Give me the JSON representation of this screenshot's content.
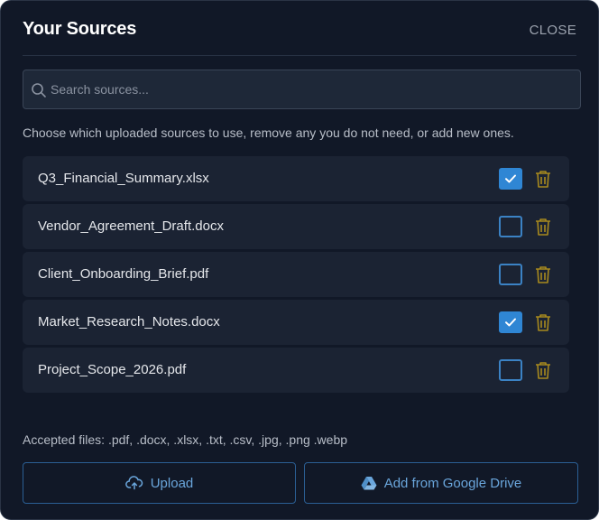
{
  "dialog": {
    "title": "Your Sources",
    "close_label": "CLOSE"
  },
  "search": {
    "placeholder": "Search sources...",
    "value": ""
  },
  "description": "Choose which uploaded sources to use, remove any you do not need, or add new ones.",
  "sources": [
    {
      "name": "Q3_Financial_Summary.xlsx",
      "selected": true
    },
    {
      "name": "Vendor_Agreement_Draft.docx",
      "selected": false
    },
    {
      "name": "Client_Onboarding_Brief.pdf",
      "selected": false
    },
    {
      "name": "Market_Research_Notes.docx",
      "selected": true
    },
    {
      "name": "Project_Scope_2026.pdf",
      "selected": false
    }
  ],
  "accepted_files": "Accepted files: .pdf, .docx, .xlsx, .txt, .csv, .jpg, .png .webp",
  "actions": {
    "upload_label": "Upload",
    "drive_label": "Add from Google Drive"
  },
  "icons": {
    "search": "search-icon",
    "checkbox": "check-icon",
    "delete": "trash-icon",
    "upload": "cloud-upload-icon",
    "drive": "google-drive-icon"
  },
  "colors": {
    "background": "#111827",
    "row_background": "#1b2333",
    "accent": "#2f86d4",
    "trash": "#a88a1e",
    "button_text": "#6aa6dc"
  }
}
